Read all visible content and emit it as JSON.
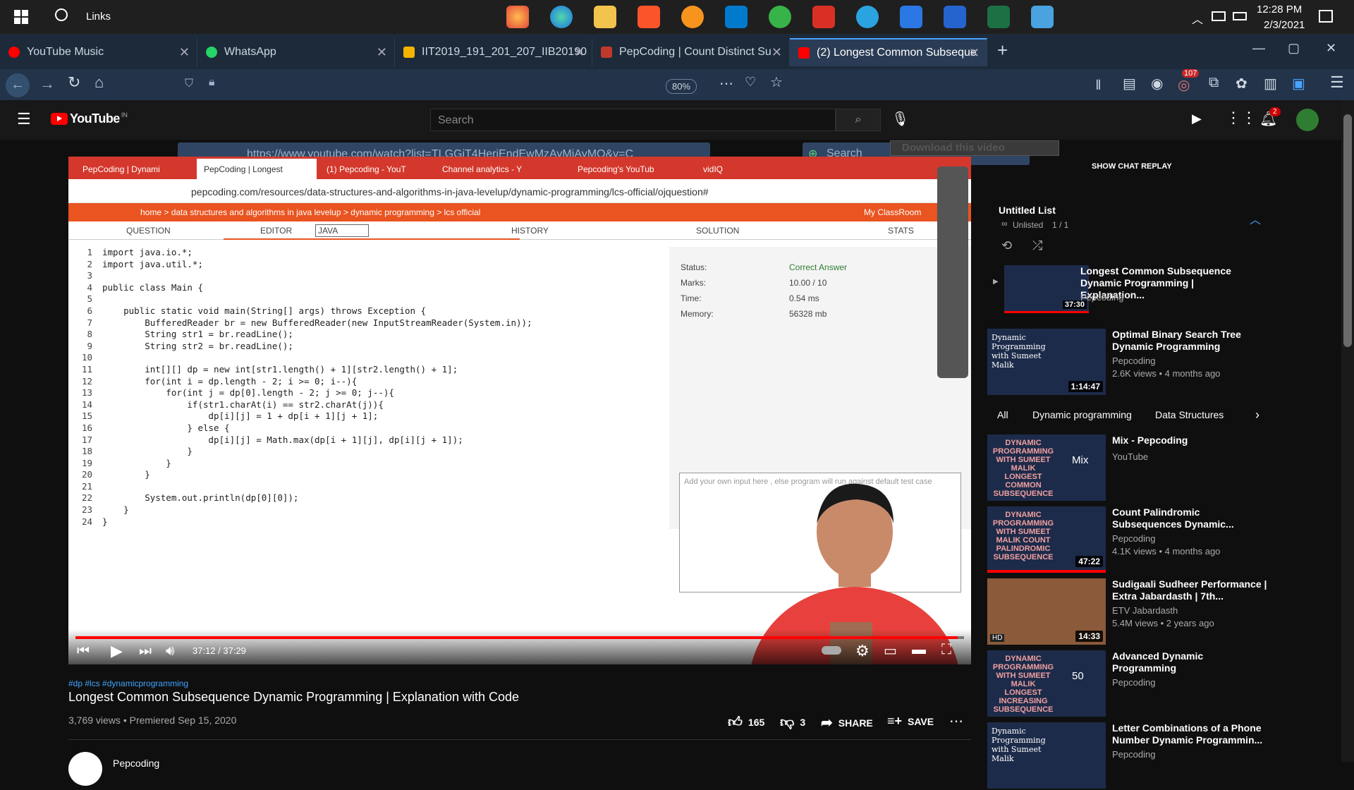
{
  "taskbar": {
    "search_label": "Links",
    "time": "12:28 PM",
    "date": "2/3/2021"
  },
  "browser": {
    "tabs": [
      {
        "label": "YouTube Music",
        "color": "#ff0000"
      },
      {
        "label": "WhatsApp",
        "color": "#25d366"
      },
      {
        "label": "IIT2019_191_201_207_IIB20190",
        "color": "#f4b400"
      },
      {
        "label": "PepCoding | Count Distinct Su",
        "color": "#c0392b"
      },
      {
        "label": "(2) Longest Common Subseque",
        "color": "#ff0000"
      }
    ],
    "url": "https://www.youtube.com/watch?list=TLGGjT4HeriEndEwMzAyMjAyMQ&v=C",
    "zoom": "80%",
    "search_placeholder": "Search",
    "badge": "107"
  },
  "youtube": {
    "logo": "YouTube",
    "country": "IN",
    "search_placeholder": "Search",
    "notif_count": "2",
    "download_label": "Download this video",
    "show_chat": "SHOW CHAT REPLAY"
  },
  "video": {
    "tabs": [
      "PepCoding | Dynami",
      "PepCoding | Longest",
      "(1) Pepcoding - YouT",
      "Channel analytics - Y",
      "Pepcoding's YouTub",
      "vidIQ"
    ],
    "url": "pepcoding.com/resources/data-structures-and-algorithms-in-java-levelup/dynamic-programming/lcs-official/ojquestion#",
    "breadcrumb": "home > data structures and algorithms in java levelup > dynamic programming > lcs official",
    "classroom": "My ClassRoom",
    "toolbar": {
      "question": "QUESTION",
      "editor": "EDITOR",
      "lang": "JAVA",
      "history": "HISTORY",
      "solution": "SOLUTION",
      "stats": "STATS"
    },
    "code": [
      "import java.io.*;",
      "import java.util.*;",
      "",
      "public class Main {",
      "",
      "    public static void main(String[] args) throws Exception {",
      "        BufferedReader br = new BufferedReader(new InputStreamReader(System.in));",
      "        String str1 = br.readLine();",
      "        String str2 = br.readLine();",
      "",
      "        int[][] dp = new int[str1.length() + 1][str2.length() + 1];",
      "        for(int i = dp.length - 2; i >= 0; i--){",
      "            for(int j = dp[0].length - 2; j >= 0; j--){",
      "                if(str1.charAt(i) == str2.charAt(j)){",
      "                    dp[i][j] = 1 + dp[i + 1][j + 1];",
      "                } else {",
      "                    dp[i][j] = Math.max(dp[i + 1][j], dp[i][j + 1]);",
      "                }",
      "            }",
      "        }",
      "",
      "        System.out.println(dp[0][0]);",
      "    }",
      "}"
    ],
    "result": {
      "status_label": "Status:",
      "status": "Correct Answer",
      "marks_label": "Marks:",
      "marks": "10.00 / 10",
      "time_label": "Time:",
      "time": "0.54 ms",
      "memory_label": "Memory:",
      "memory": "56328 mb"
    },
    "input_placeholder": "Add your own input here , else program will run against default test case",
    "current_time": "37:12 / 37:29",
    "progress": 0.9925
  },
  "watch": {
    "hashtags": "#dp #lcs #dynamicprogramming",
    "title": "Longest Common Subsequence Dynamic Programming | Explanation with Code",
    "stats": "3,769 views • Premiered Sep 15, 2020",
    "likes": "165",
    "dislikes": "3",
    "share": "SHARE",
    "save": "SAVE",
    "channel": "Pepcoding"
  },
  "playlist": {
    "title": "Untitled List",
    "status": "Unlisted",
    "position": "1 / 1",
    "item": {
      "title": "Longest Common Subsequence Dynamic Programming | Explanation...",
      "channel": "Pepcoding",
      "duration": "37:30"
    }
  },
  "chips": [
    "All",
    "Dynamic programming",
    "Data Structures"
  ],
  "recommendations": [
    {
      "title": "Optimal Binary Search Tree Dynamic Programming",
      "channel": "Pepcoding",
      "meta": "2.6K views • 4 months ago",
      "duration": "1:14:47",
      "thumb": "Dynamic Programming with Sumeet Malik"
    },
    {
      "title": "Mix - Pepcoding",
      "channel": "YouTube",
      "meta": "",
      "duration": "",
      "thumb": "DYNAMIC PROGRAMMING WITH SUMEET MALIK LONGEST COMMON SUBSEQUENCE",
      "mix": "Mix"
    },
    {
      "title": "Count Palindromic Subsequences Dynamic...",
      "channel": "Pepcoding",
      "meta": "4.1K views • 4 months ago",
      "duration": "47:22",
      "thumb": "DYNAMIC PROGRAMMING WITH SUMEET MALIK COUNT PALINDROMIC SUBSEQUENCE"
    },
    {
      "title": "Sudigaali Sudheer Performance | Extra Jabardasth | 7th...",
      "channel": "ETV Jabardasth",
      "meta": "5.4M views • 2 years ago",
      "duration": "14:33",
      "thumb": "HD"
    },
    {
      "title": "Advanced Dynamic Programming",
      "channel": "Pepcoding",
      "meta": "",
      "duration": "50",
      "thumb": "DYNAMIC PROGRAMMING WITH SUMEET MALIK LONGEST INCREASING SUBSEQUENCE"
    },
    {
      "title": "Letter Combinations of a Phone Number Dynamic Programmin...",
      "channel": "Pepcoding",
      "meta": "",
      "duration": "",
      "thumb": "Dynamic Programming with Sumeet Malik"
    }
  ]
}
